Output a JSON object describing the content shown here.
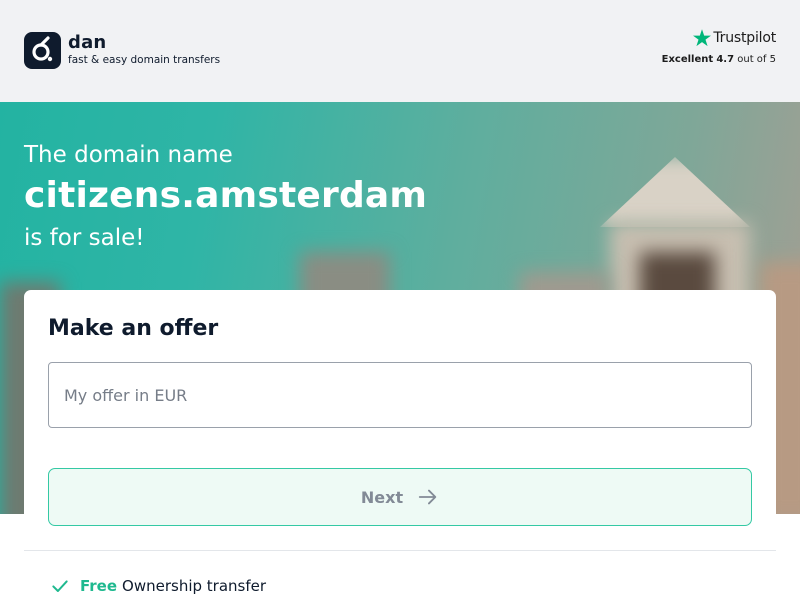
{
  "brand": {
    "name": "dan",
    "tagline": "fast & easy domain transfers"
  },
  "trustpilot": {
    "name": "Trustpilot",
    "rating_label": "Excellent",
    "rating_value": "4.7",
    "rating_suffix": "out of 5"
  },
  "hero": {
    "line1": "The domain name",
    "domain": "citizens.amsterdam",
    "line3": "is for sale!"
  },
  "offer": {
    "title": "Make an offer",
    "input_placeholder": "My offer in EUR",
    "input_value": "",
    "next_label": "Next"
  },
  "features": [
    {
      "highlight": "Free",
      "text": "Ownership transfer"
    }
  ],
  "colors": {
    "brand_dark": "#0f1b2d",
    "accent_green": "#1fb98f",
    "trustpilot_green": "#00b67a",
    "hero_teal": "#2fb5a6"
  },
  "icons": {
    "logo": "dan-logo-icon",
    "trustpilot": "star-icon",
    "next": "arrow-right-icon",
    "feature": "check-icon"
  }
}
